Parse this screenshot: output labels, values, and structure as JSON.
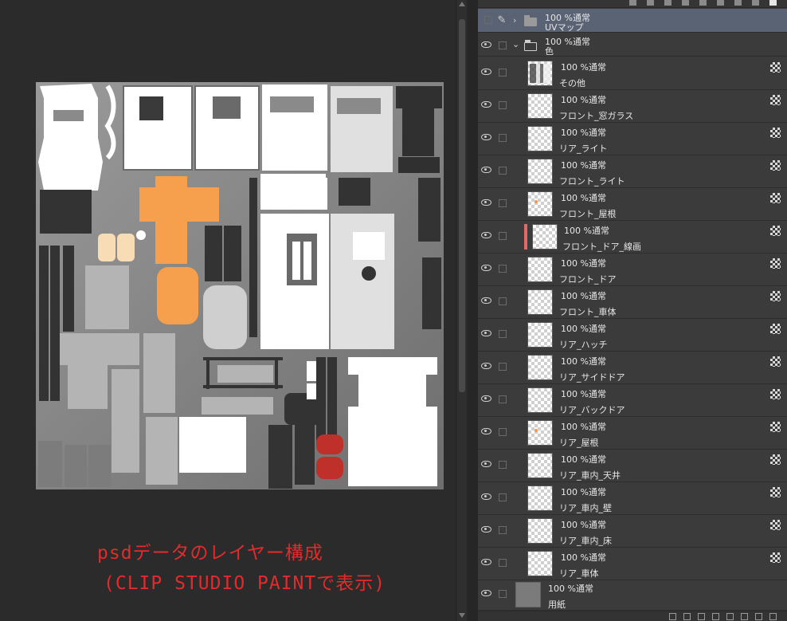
{
  "canvas": {
    "caption_line1": "psdデータのレイヤー構成",
    "caption_line2": "(CLIP STUDIO PAINTで表示)",
    "caption_color": "#e32b2b"
  },
  "colors": {
    "orange": "#f6a04d",
    "red": "#c0302a",
    "white": "#ffffff",
    "dark": "#333333",
    "mid": "#b4b4b4",
    "selected_row": "#5a6373",
    "mark_red": "#e06a6a"
  },
  "layers": {
    "uv_folder": {
      "mode": "100 %通常",
      "name": "UVマップ",
      "icon": "folder-closed-icon"
    },
    "color_folder": {
      "mode": "100 %通常",
      "name": "色",
      "icon": "folder-open-icon"
    },
    "items": [
      {
        "mode": "100 %通常",
        "name": "その他",
        "thumb": "mixed"
      },
      {
        "mode": "100 %通常",
        "name": "フロント_窓ガラス",
        "thumb": "transparent"
      },
      {
        "mode": "100 %通常",
        "name": "リア_ライト",
        "thumb": "transparent"
      },
      {
        "mode": "100 %通常",
        "name": "フロント_ライト",
        "thumb": "transparent"
      },
      {
        "mode": "100 %通常",
        "name": "フロント_屋根",
        "thumb": "orange-dot"
      },
      {
        "mode": "100 %通常",
        "name": "フロント_ドア_線画",
        "thumb": "transparent",
        "marked": true
      },
      {
        "mode": "100 %通常",
        "name": "フロント_ドア",
        "thumb": "transparent"
      },
      {
        "mode": "100 %通常",
        "name": "フロント_車体",
        "thumb": "transparent"
      },
      {
        "mode": "100 %通常",
        "name": "リア_ハッチ",
        "thumb": "transparent"
      },
      {
        "mode": "100 %通常",
        "name": "リア_サイドドア",
        "thumb": "transparent"
      },
      {
        "mode": "100 %通常",
        "name": "リア_バックドア",
        "thumb": "transparent"
      },
      {
        "mode": "100 %通常",
        "name": "リア_屋根",
        "thumb": "orange-dot"
      },
      {
        "mode": "100 %通常",
        "name": "リア_車内_天井",
        "thumb": "transparent"
      },
      {
        "mode": "100 %通常",
        "name": "リア_車内_壁",
        "thumb": "transparent"
      },
      {
        "mode": "100 %通常",
        "name": "リア_車内_床",
        "thumb": "transparent"
      },
      {
        "mode": "100 %通常",
        "name": "リア_車体",
        "thumb": "transparent"
      }
    ],
    "paper": {
      "mode": "100 %通常",
      "name": "用紙",
      "thumb": "gray"
    }
  }
}
